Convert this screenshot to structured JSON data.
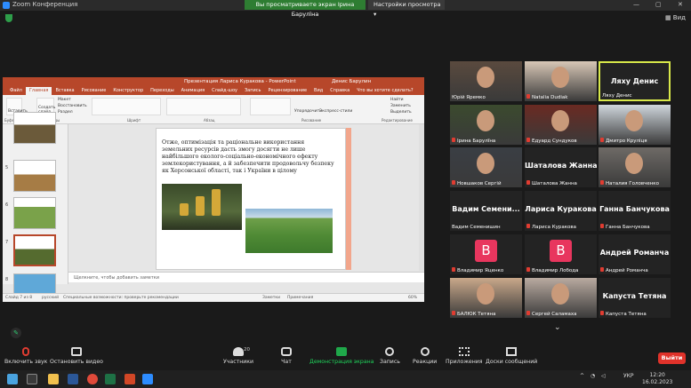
{
  "window": {
    "title": "Zoom Конференция"
  },
  "banner": {
    "text": "Вы просматриваете экран Ірина Барулїна",
    "view_settings": "Настройки просмотра"
  },
  "top_right": {
    "view_label": "Вид"
  },
  "ppt": {
    "title": "Презентация Лариса Куракова - PowerPoint",
    "user": "Денис Барулин",
    "tabs": [
      "Файл",
      "Главная",
      "Вставка",
      "Рисование",
      "Конструктор",
      "Переходы",
      "Анимация",
      "Слайд-шоу",
      "Запись",
      "Рецензирование",
      "Вид",
      "Справка",
      "Что вы хотите сделать?"
    ],
    "ribbon": {
      "paste": "Вставить",
      "new_slide": "Создать слайд",
      "layout": "Макет",
      "reset": "Восстановить",
      "section": "Раздел",
      "clipboard": "Буфер обмена",
      "slides": "Слайды",
      "font": "Шрифт",
      "paragraph": "Абзац",
      "arrange": "Упорядочить",
      "quick_styles": "Экспресс-стили",
      "drawing": "Рисование",
      "find": "Найти",
      "replace": "Заменить",
      "select": "Выделить",
      "editing": "Редактирование"
    },
    "thumb_numbers": [
      "",
      "5",
      "6",
      "7",
      "8"
    ],
    "slide_text": "Отже, оптимізація та раціональне використання земельних ресурсів дасть змогу досягти не лише найбільшого еколого-соціально-економічного ефекту землекористування, а й забезпечити продовольчу безпеку як Херсонської області, так і України в цілому",
    "notes_placeholder": "Щелкните, чтобы добавить заметки",
    "status_slide": "Слайд 7 из 8",
    "status_lang": "русский",
    "status_access": "Специальные возможности: проверьте рекомендации",
    "status_notes": "Заметки",
    "status_comments": "Примечания",
    "zoom": "60%"
  },
  "participants": [
    {
      "name": "Юрій Яремко",
      "muted": false,
      "type": "video"
    },
    {
      "name": "Natalia Dudiak",
      "muted": true,
      "type": "video"
    },
    {
      "name": "Ляху Денис",
      "muted": false,
      "type": "name",
      "big": "Ляху Денис",
      "active": true
    },
    {
      "name": "Ірина Барулїна",
      "muted": true,
      "type": "video"
    },
    {
      "name": "Едуард Сундуков",
      "muted": true,
      "type": "video"
    },
    {
      "name": "Дмитро Круліця",
      "muted": true,
      "type": "video"
    },
    {
      "name": "Новшаков Сергій",
      "muted": true,
      "type": "video"
    },
    {
      "name": "Шаталова Жанна",
      "muted": true,
      "type": "name",
      "big": "Шаталова Жанна"
    },
    {
      "name": "Наталия Головченко",
      "muted": true,
      "type": "video"
    },
    {
      "name": "Вадим Семенишин",
      "muted": false,
      "type": "name",
      "big": "Вадим  Семени..."
    },
    {
      "name": "Лариса Куракова",
      "muted": true,
      "type": "name",
      "big": "Лариса Куракова"
    },
    {
      "name": "Ганна Банчукова",
      "muted": true,
      "type": "name",
      "big": "Ганна Банчукова"
    },
    {
      "name": "Владимир Яценко",
      "muted": true,
      "type": "avatar",
      "letter": "B"
    },
    {
      "name": "Владимир Лобода",
      "muted": true,
      "type": "avatar",
      "letter": "B"
    },
    {
      "name": "Андрей Романча",
      "muted": true,
      "type": "name",
      "big": "Андрей Романча"
    },
    {
      "name": "БАЛЮК Тетяна",
      "muted": true,
      "type": "video"
    },
    {
      "name": "Сергей Саламаха",
      "muted": true,
      "type": "video"
    },
    {
      "name": "Капуста Тетяна",
      "muted": true,
      "type": "name",
      "big": "Капуста Тетяна"
    }
  ],
  "toolbar": {
    "unmute": "Включить звук",
    "start_video": "Остановить видео",
    "participants": "Участники",
    "participants_count": "20",
    "chat": "Чат",
    "share": "Демонстрация экрана",
    "record": "Запись",
    "reactions": "Реакции",
    "apps": "Приложения",
    "whiteboards": "Доски сообщений",
    "leave": "Выйти"
  },
  "taskbar": {
    "lang": "УКР",
    "time": "12:20",
    "date": "16.02.2023"
  },
  "colors": {
    "accent": "#b7472a",
    "share_green": "#1fa84a",
    "leave_red": "#e0322a",
    "active_border": "#d8e84a"
  }
}
